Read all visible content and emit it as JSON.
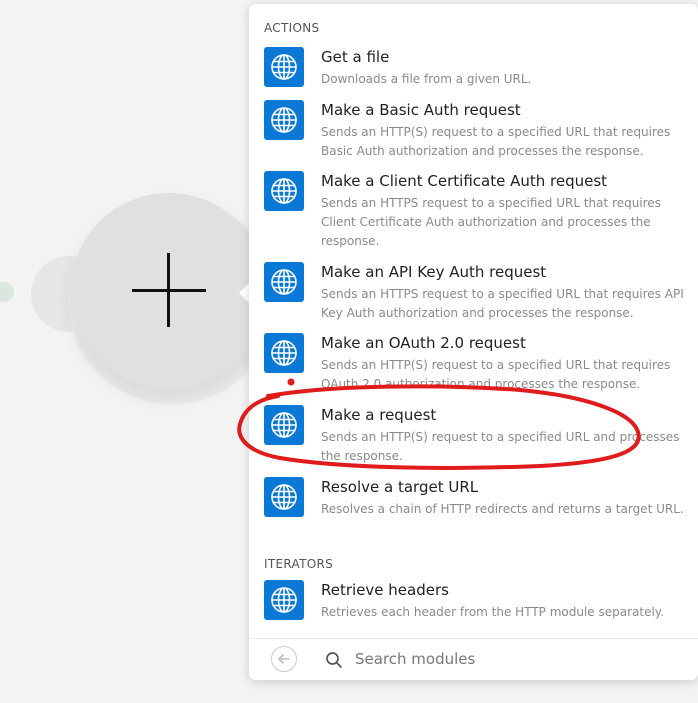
{
  "panel": {
    "sections": [
      {
        "title": "ACTIONS",
        "items": [
          {
            "title": "Get a file",
            "description": "Downloads a file from a given URL.",
            "icon": "globe-icon"
          },
          {
            "title": "Make a Basic Auth request",
            "description": "Sends an HTTP(S) request to a specified URL that requires Basic Auth authorization and processes the response.",
            "icon": "globe-icon"
          },
          {
            "title": "Make a Client Certificate Auth request",
            "description": "Sends an HTTPS request to a specified URL that requires Client Certificate Auth authorization and processes the response.",
            "icon": "globe-icon"
          },
          {
            "title": "Make an API Key Auth request",
            "description": "Sends an HTTPS request to a specified URL that requires API Key Auth authorization and processes the response.",
            "icon": "globe-icon"
          },
          {
            "title": "Make an OAuth 2.0 request",
            "description": "Sends an HTTP(S) request to a specified URL that requires OAuth 2.0 authorization and processes the response.",
            "icon": "globe-icon"
          },
          {
            "title": "Make a request",
            "description": "Sends an HTTP(S) request to a specified URL and processes the response.",
            "icon": "globe-icon"
          },
          {
            "title": "Resolve a target URL",
            "description": "Resolves a chain of HTTP redirects and returns a target URL.",
            "icon": "globe-icon"
          }
        ]
      },
      {
        "title": "ITERATORS",
        "items": [
          {
            "title": "Retrieve headers",
            "description": "Retrieves each header from the HTTP module separately.",
            "icon": "globe-icon"
          }
        ]
      }
    ],
    "search": {
      "placeholder": "Search modules",
      "value": ""
    }
  },
  "colors": {
    "icon_bg": "#0a78d6",
    "annotation": "#e01b1b"
  }
}
